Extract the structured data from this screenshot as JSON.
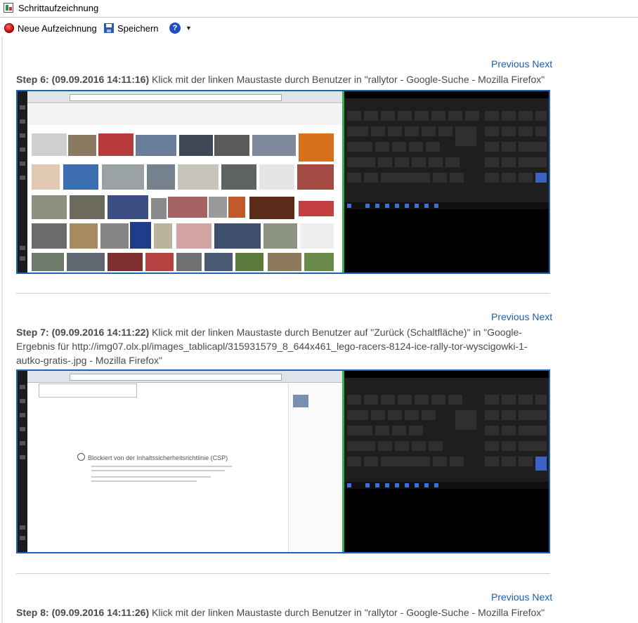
{
  "window": {
    "title": "Schrittaufzeichnung"
  },
  "toolbar": {
    "new_recording_label": "Neue Aufzeichnung",
    "save_label": "Speichern",
    "help_icon": "help-icon",
    "dropdown_icon": "chevron-down-icon"
  },
  "nav": {
    "previous_label": "Previous",
    "next_label": "Next"
  },
  "steps": [
    {
      "heading": "Step 6: (09.09.2016 14:11:16)",
      "description": " Klick mit der linken Maustaste durch Benutzer in \"rallytor - Google-Suche - Mozilla Firefox\""
    },
    {
      "heading": "Step 7: (09.09.2016 14:11:22)",
      "description": " Klick mit der linken Maustaste durch Benutzer auf \"Zurück (Schaltfläche)\" in \"Google-Ergebnis für http://img07.olx.pl/images_tablicapl/315931579_8_644x461_lego-racers-8124-ice-rally-tor-wyscigowki-1-autko-gratis-.jpg - Mozilla Firefox\"",
      "csp_text": "Blockiert von der Inhaltssicherheitsrichtlinie (CSP)"
    },
    {
      "heading": "Step 8: (09.09.2016 14:11:26)",
      "description": " Klick mit der linken Maustaste durch Benutzer in \"rallytor - Google-Suche - Mozilla Firefox\""
    }
  ],
  "colors": {
    "link": "#1a5fb4",
    "screenshot_border": "#1e64b4",
    "record": "#c00000"
  }
}
